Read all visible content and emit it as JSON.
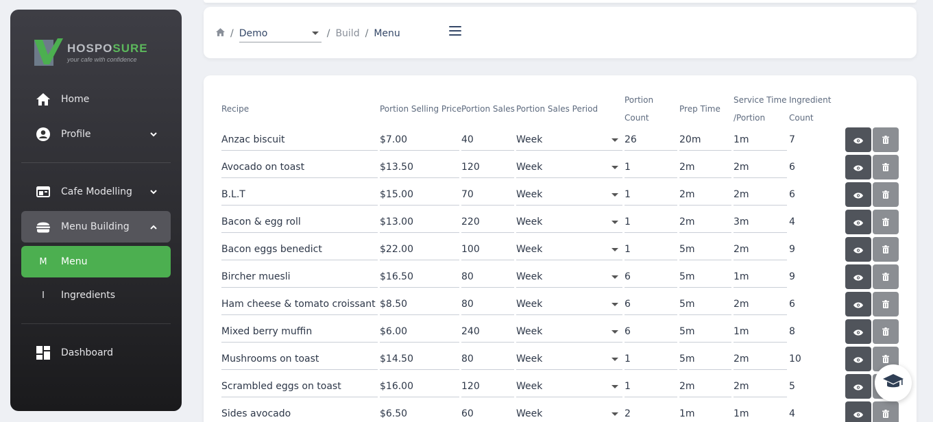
{
  "brand": {
    "name_part1": "HOSPO",
    "name_part2": "SURE",
    "tagline": "your cafe with confidence",
    "colors": {
      "green": "#5cb85c",
      "grey": "#b9bcc2"
    }
  },
  "sidebar": {
    "items": [
      {
        "label": "Home",
        "icon": "home-icon"
      },
      {
        "label": "Profile",
        "icon": "account-circle-icon"
      },
      {
        "label": "Cafe Modelling",
        "icon": "calendar-view-icon"
      },
      {
        "label": "Menu Building",
        "icon": "burger-icon"
      },
      {
        "label": "Menu",
        "letter": "M"
      },
      {
        "label": "Ingredients",
        "letter": "I"
      },
      {
        "label": "Dashboard",
        "icon": "dashboard-icon"
      }
    ],
    "active_color": "#4caf50"
  },
  "breadcrumb": {
    "venue": "Demo",
    "section": "Build",
    "page": "Menu"
  },
  "table": {
    "headers": {
      "recipe": "Recipe",
      "price": "Portion Selling Price",
      "sales": "Portion Sales",
      "period": "Portion Sales Period",
      "count_1": "Portion",
      "count_2": "Count",
      "prep": "Prep Time",
      "service_1": "Service Time",
      "service_2": "/Portion",
      "ingredient_1": "Ingredient",
      "ingredient_2": "Count"
    },
    "rows": [
      {
        "recipe": "Anzac biscuit",
        "price": "$7.00",
        "sales": "40",
        "period": "Week",
        "count": "26",
        "prep": "20m",
        "service": "1m",
        "ingredients": "7"
      },
      {
        "recipe": "Avocado on toast",
        "price": "$13.50",
        "sales": "120",
        "period": "Week",
        "count": "1",
        "prep": "2m",
        "service": "2m",
        "ingredients": "6"
      },
      {
        "recipe": "B.L.T",
        "price": "$15.00",
        "sales": "70",
        "period": "Week",
        "count": "1",
        "prep": "2m",
        "service": "2m",
        "ingredients": "6"
      },
      {
        "recipe": "Bacon & egg roll",
        "price": "$13.00",
        "sales": "220",
        "period": "Week",
        "count": "1",
        "prep": "2m",
        "service": "3m",
        "ingredients": "4"
      },
      {
        "recipe": "Bacon eggs benedict",
        "price": "$22.00",
        "sales": "100",
        "period": "Week",
        "count": "1",
        "prep": "5m",
        "service": "2m",
        "ingredients": "9"
      },
      {
        "recipe": "Bircher muesli",
        "price": "$16.50",
        "sales": "80",
        "period": "Week",
        "count": "6",
        "prep": "5m",
        "service": "1m",
        "ingredients": "9"
      },
      {
        "recipe": "Ham cheese & tomato croissant",
        "price": "$8.50",
        "sales": "80",
        "period": "Week",
        "count": "6",
        "prep": "5m",
        "service": "2m",
        "ingredients": "6"
      },
      {
        "recipe": "Mixed berry muffin",
        "price": "$6.00",
        "sales": "240",
        "period": "Week",
        "count": "6",
        "prep": "5m",
        "service": "1m",
        "ingredients": "8"
      },
      {
        "recipe": "Mushrooms on toast",
        "price": "$14.50",
        "sales": "80",
        "period": "Week",
        "count": "1",
        "prep": "5m",
        "service": "2m",
        "ingredients": "10"
      },
      {
        "recipe": "Scrambled eggs on toast",
        "price": "$16.00",
        "sales": "120",
        "period": "Week",
        "count": "1",
        "prep": "2m",
        "service": "2m",
        "ingredients": "5"
      },
      {
        "recipe": "Sides avocado",
        "price": "$6.50",
        "sales": "60",
        "period": "Week",
        "count": "2",
        "prep": "1m",
        "service": "1m",
        "ingredients": "4"
      }
    ],
    "actions": {
      "view_icon": "eye-icon",
      "delete_icon": "trash-icon"
    }
  },
  "help_fab": {
    "icon": "graduation-cap-icon"
  }
}
